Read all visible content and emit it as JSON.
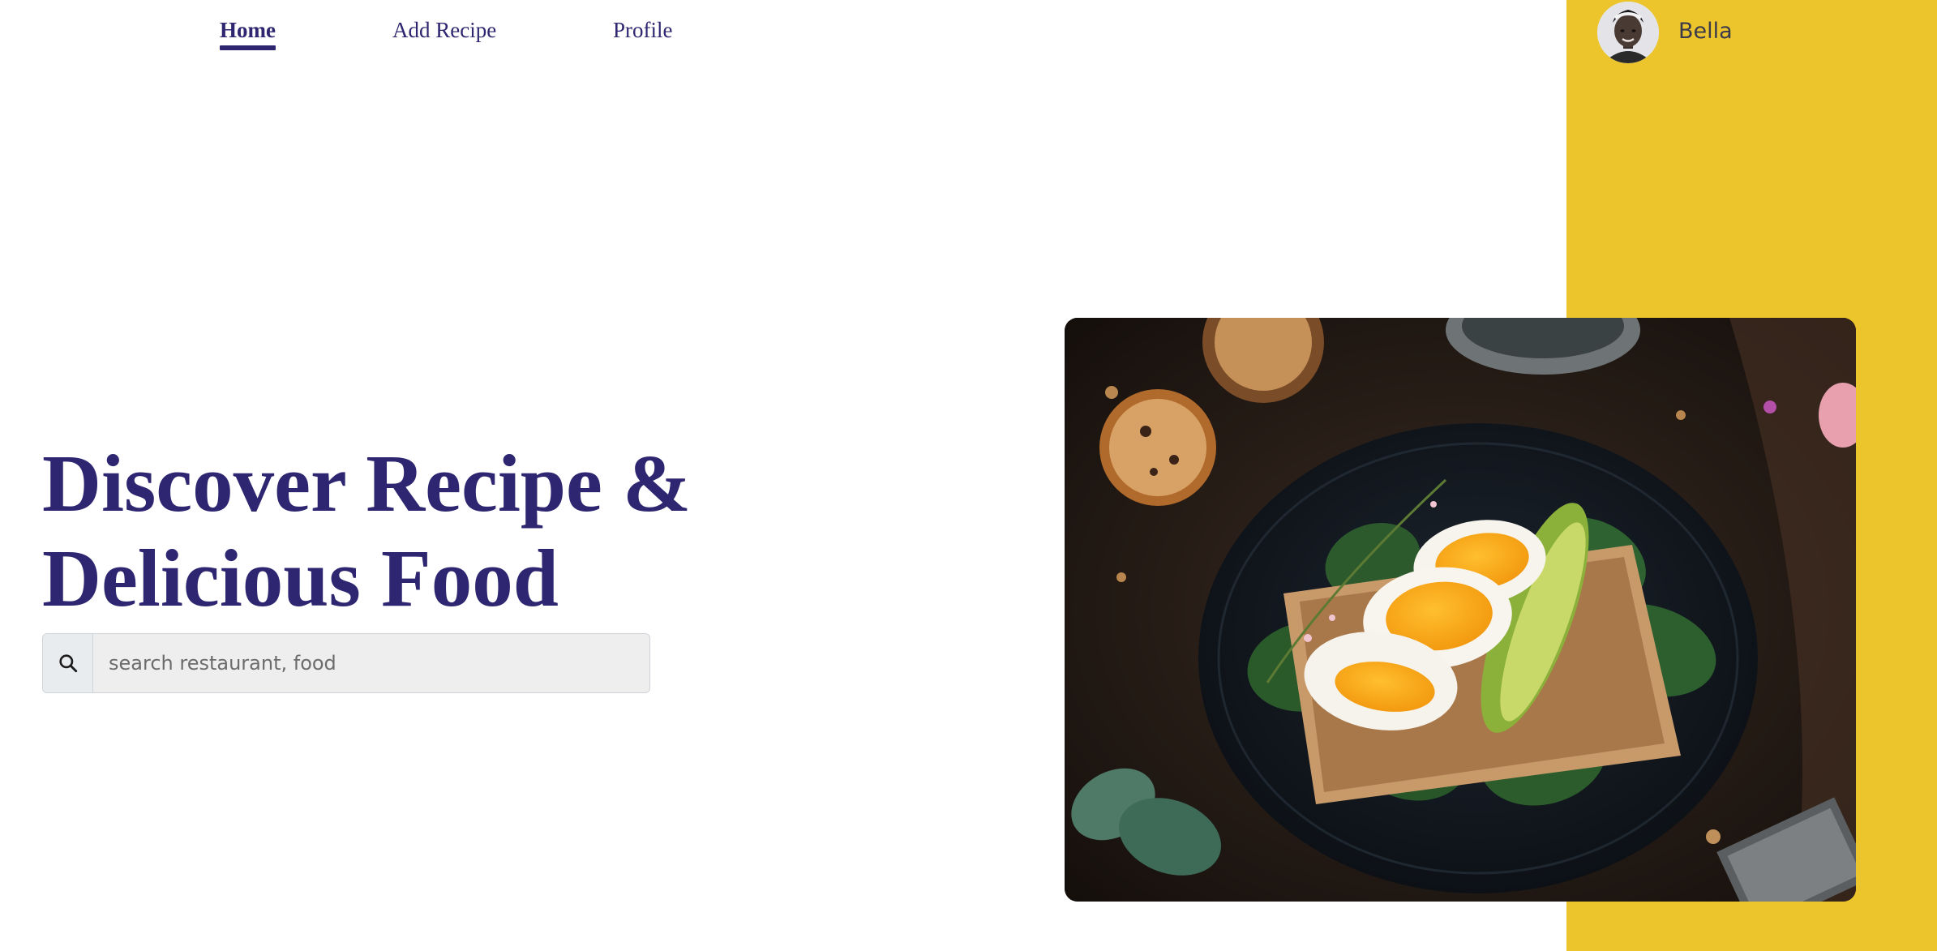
{
  "nav": {
    "items": [
      {
        "label": "Home",
        "active": true
      },
      {
        "label": "Add Recipe",
        "active": false
      },
      {
        "label": "Profile",
        "active": false
      }
    ]
  },
  "user": {
    "name": "Bella"
  },
  "hero": {
    "title_line1": "Discover Recipe &",
    "title_line2": "Delicious Food"
  },
  "search": {
    "placeholder": "search restaurant, food",
    "value": ""
  },
  "colors": {
    "accent": "#2E2670",
    "panel": "#ECC42C"
  },
  "icons": {
    "search": "search-icon"
  }
}
